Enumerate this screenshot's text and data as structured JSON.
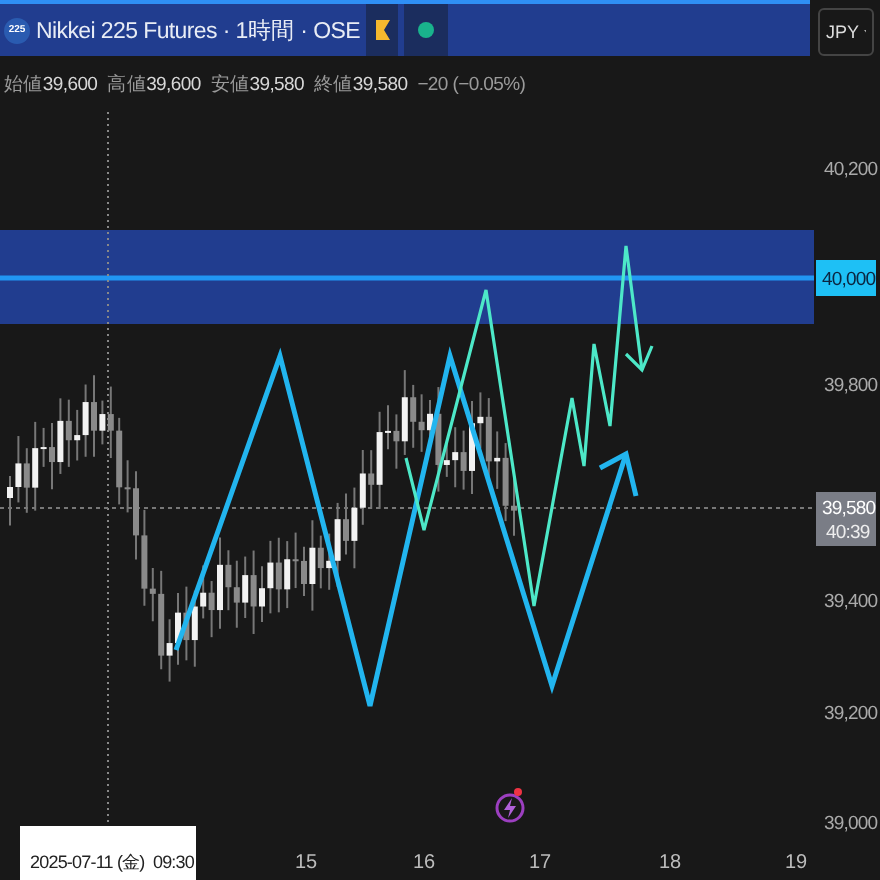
{
  "header": {
    "symbol_badge": "225",
    "title": "Nikkei 225 Futures · 1時間 · OSE",
    "currency": "JPY"
  },
  "ohlc": [
    {
      "label": "始値",
      "value": "39,600"
    },
    {
      "label": "高値",
      "value": "39,600"
    },
    {
      "label": "安値",
      "value": "39,580"
    },
    {
      "label": "終値",
      "value": "39,580"
    }
  ],
  "change": "−20 (−0.05%)",
  "price_axis": [
    {
      "label": "40,200",
      "kind": "tick"
    },
    {
      "label": "40,000",
      "kind": "level"
    },
    {
      "label": "39,800",
      "kind": "tick"
    },
    {
      "label": "39,400",
      "kind": "tick"
    },
    {
      "label": "39,200",
      "kind": "tick"
    },
    {
      "label": "39,000",
      "kind": "tick"
    }
  ],
  "last_price": {
    "price": "39,580",
    "countdown": "40:39"
  },
  "time_axis": {
    "cursor_label": "2025-07-11 (金)  09:30",
    "ticks": [
      "15",
      "16",
      "17",
      "18",
      "19"
    ]
  }
}
